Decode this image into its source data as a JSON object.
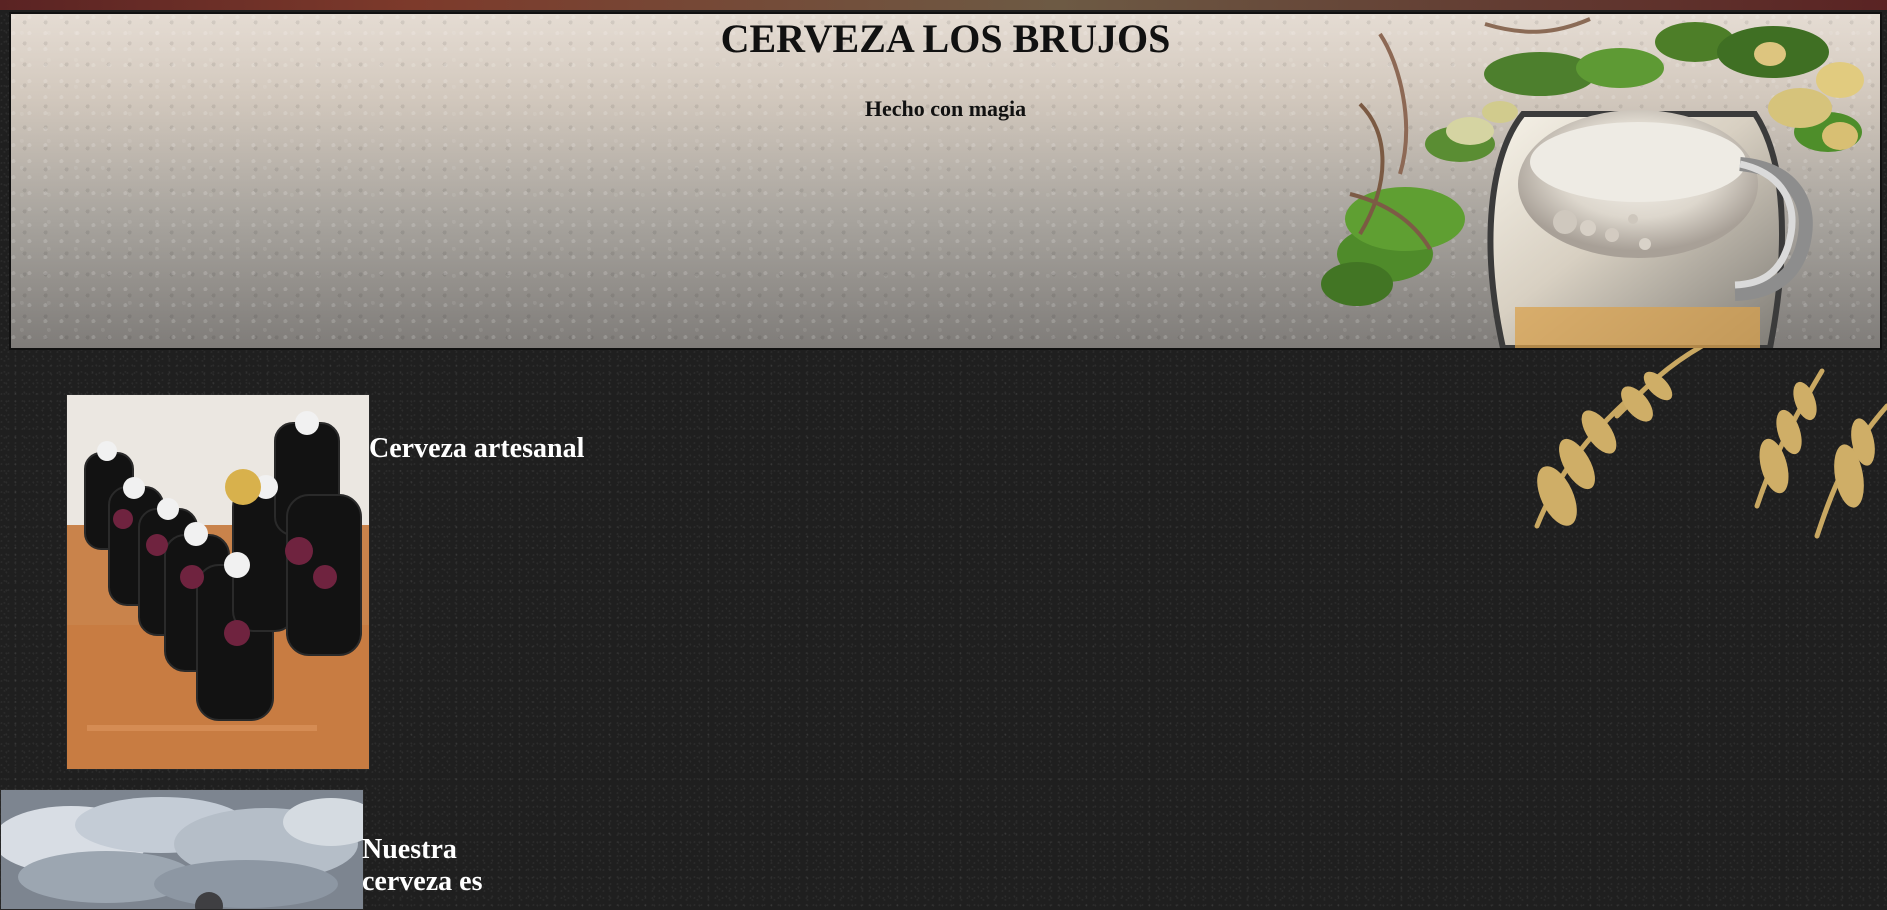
{
  "header": {
    "title": "CERVEZA LOS BRUJOS",
    "subtitle": "Hecho con magia"
  },
  "features": [
    {
      "title": "Cerveza artesanal",
      "image_icon": "beer-bottles-image"
    },
    {
      "title": "Nuestra cerveza es",
      "image_icon": "sky-image"
    }
  ],
  "decor": {
    "hero_art_icon": "hops-and-beer-mug-art",
    "wheat_icon": "wheat-decoration"
  },
  "colors": {
    "page_background": "#1f1f1f",
    "text_light": "#ffffff",
    "text_dark": "#111111"
  }
}
